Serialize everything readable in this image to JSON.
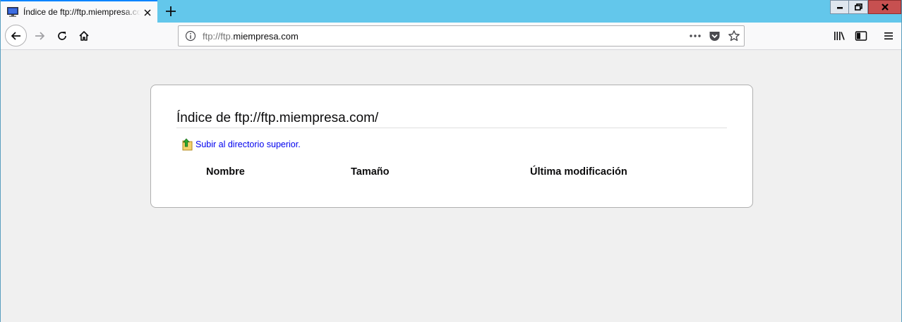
{
  "browser": {
    "tab": {
      "title": "Índice de ftp://ftp.miempresa.com/"
    },
    "url": {
      "prefix": "ftp://ftp.",
      "host": "miempresa.com"
    }
  },
  "page": {
    "heading": "Índice de ftp://ftp.miempresa.com/",
    "up_link": "Subir al directorio superior.",
    "columns": [
      "Nombre",
      "Tamaño",
      "Última modificación"
    ]
  },
  "colors": {
    "titlebar": "#63c7eb",
    "link": "#0000ee",
    "close": "#c75050"
  }
}
